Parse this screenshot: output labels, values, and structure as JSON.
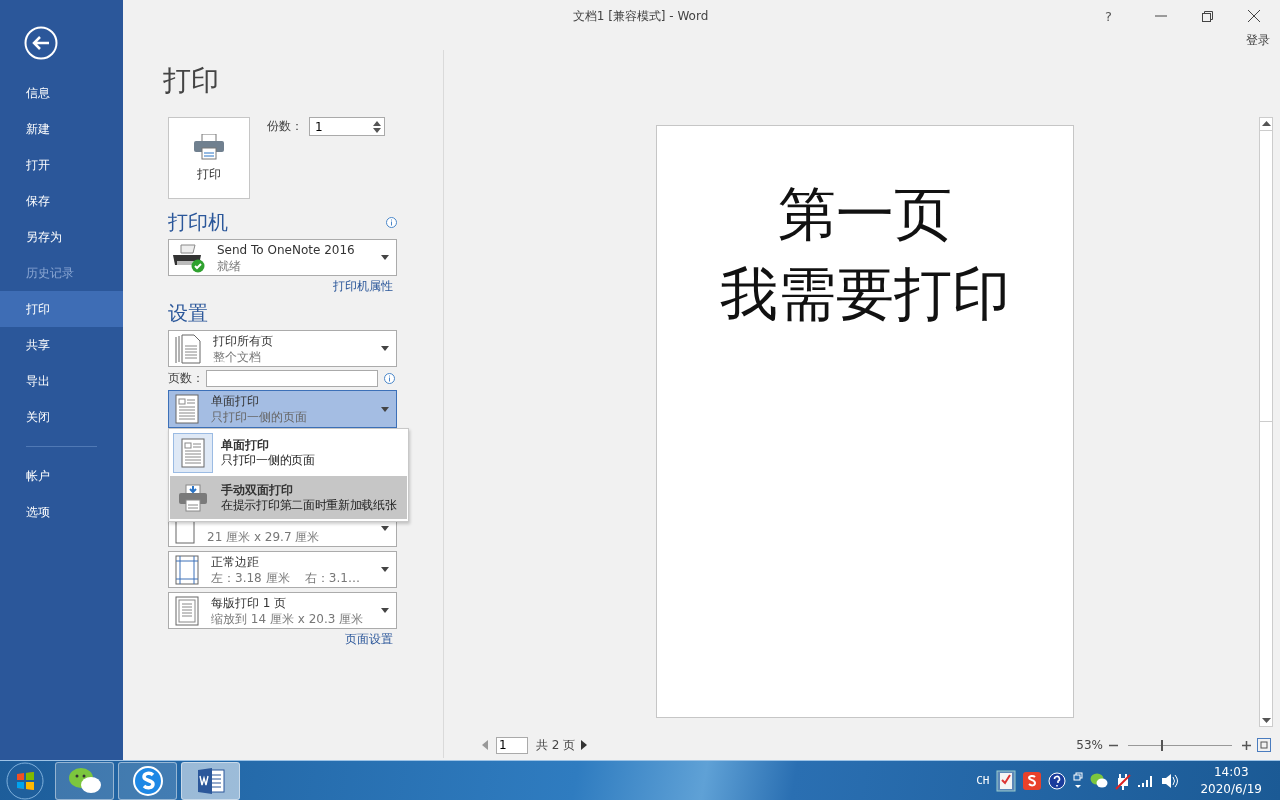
{
  "window": {
    "title": "文档1 [兼容模式] - Word",
    "help": "?",
    "sign_in": "登录"
  },
  "sidebar": {
    "items": [
      {
        "label": "信息",
        "selected": false,
        "disabled": false
      },
      {
        "label": "新建",
        "selected": false,
        "disabled": false
      },
      {
        "label": "打开",
        "selected": false,
        "disabled": false
      },
      {
        "label": "保存",
        "selected": false,
        "disabled": false
      },
      {
        "label": "另存为",
        "selected": false,
        "disabled": false
      },
      {
        "label": "历史记录",
        "selected": false,
        "disabled": true
      },
      {
        "label": "打印",
        "selected": true,
        "disabled": false
      },
      {
        "label": "共享",
        "selected": false,
        "disabled": false
      },
      {
        "label": "导出",
        "selected": false,
        "disabled": false
      },
      {
        "label": "关闭",
        "selected": false,
        "disabled": false
      }
    ],
    "bottom_items": [
      {
        "label": "帐户",
        "selected": false,
        "disabled": false
      },
      {
        "label": "选项",
        "selected": false,
        "disabled": false
      }
    ]
  },
  "print": {
    "heading": "打印",
    "button": "打印",
    "copies_label": "份数：",
    "copies": "1"
  },
  "printer": {
    "heading": "打印机",
    "name": "Send To OneNote 2016",
    "status": "就绪",
    "properties_link": "打印机属性"
  },
  "settings": {
    "heading": "设置",
    "pages_label": "页数：",
    "page_setup_link": "页面设置",
    "options": [
      {
        "kind": "all-pages",
        "title": "打印所有页",
        "subtitle": "整个文档",
        "open": false
      },
      {
        "kind": "pages-field"
      },
      {
        "kind": "simplex",
        "title": "单面打印",
        "subtitle": "只打印一侧的页面",
        "open": true
      },
      {
        "kind": "hidden"
      },
      {
        "kind": "paper",
        "subtitle": "21 厘米 x 29.7 厘米",
        "open": false
      },
      {
        "kind": "margins",
        "title": "正常边距",
        "subtitle": "左：3.18 厘米    右：3.1…",
        "open": false
      },
      {
        "kind": "per-sheet",
        "title": "每版打印 1 页",
        "subtitle": "缩放到 14 厘米 x 20.3 厘米",
        "open": false
      }
    ]
  },
  "dropdown_menu": {
    "items": [
      {
        "kind": "simplex",
        "title": "单面打印",
        "subtitle": "只打印一侧的页面",
        "selected": true,
        "hovered": false
      },
      {
        "kind": "manual-duplex",
        "title": "手动双面打印",
        "subtitle": "在提示打印第二面时重新加载纸张",
        "selected": false,
        "hovered": true
      }
    ]
  },
  "preview": {
    "lines": [
      "第一页",
      "我需要打印"
    ],
    "page": "1",
    "page_total": "共 2 页",
    "zoom": "53%",
    "zoom_slider": {
      "level": 0.32
    }
  },
  "taskbar": {
    "apps": [
      {
        "kind": "chat",
        "selected": false
      },
      {
        "kind": "browser",
        "selected": false
      },
      {
        "kind": "word",
        "selected": true
      }
    ],
    "tray": {
      "language": "CH",
      "time": "14:03",
      "date": "2020/6/19"
    }
  }
}
